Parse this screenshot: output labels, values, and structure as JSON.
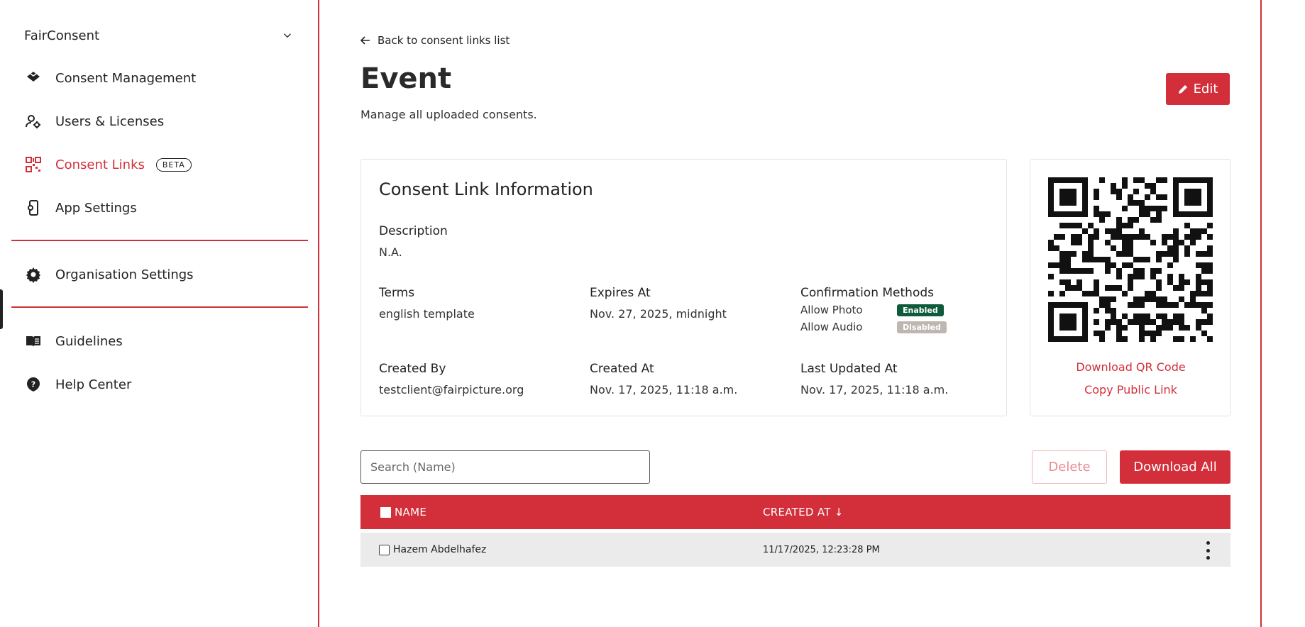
{
  "sidebar": {
    "org_name": "FairConsent",
    "items": [
      {
        "label": "Consent Management",
        "icon": "layers-icon"
      },
      {
        "label": "Users & Licenses",
        "icon": "user-gear-icon"
      },
      {
        "label": "Consent Links",
        "icon": "qr-code-icon",
        "badge": "BETA",
        "active": true
      },
      {
        "label": "App Settings",
        "icon": "device-settings-icon"
      },
      {
        "label": "Organisation Settings",
        "icon": "gear-icon"
      },
      {
        "label": "Guidelines",
        "icon": "book-icon"
      },
      {
        "label": "Help Center",
        "icon": "help-icon"
      }
    ]
  },
  "header": {
    "back_label": "Back to consent links list",
    "title": "Event",
    "subtitle": "Manage all uploaded consents.",
    "edit_label": "Edit"
  },
  "info": {
    "title": "Consent Link Information",
    "description_label": "Description",
    "description_value": "N.A.",
    "terms_label": "Terms",
    "terms_value": "english template",
    "expires_label": "Expires At",
    "expires_value": "Nov. 27, 2025, midnight",
    "methods_label": "Confirmation Methods",
    "methods": [
      {
        "name": "Allow Photo",
        "status": "Enabled"
      },
      {
        "name": "Allow Audio",
        "status": "Disabled"
      }
    ],
    "created_by_label": "Created By",
    "created_by_value": "testclient@fairpicture.org",
    "created_at_label": "Created At",
    "created_at_value": "Nov. 17, 2025, 11:18 a.m.",
    "updated_label": "Last Updated At",
    "updated_value": "Nov. 17, 2025, 11:18 a.m."
  },
  "qr": {
    "download_label": "Download QR Code",
    "copy_label": "Copy Public Link"
  },
  "table_controls": {
    "search_placeholder": "Search (Name)",
    "delete_label": "Delete",
    "download_all_label": "Download All"
  },
  "table": {
    "columns": [
      "NAME",
      "CREATED AT ↓"
    ],
    "rows": [
      {
        "name": "Hazem Abdelhafez",
        "created_at": "11/17/2025, 12:23:28 PM"
      }
    ]
  },
  "colors": {
    "accent": "#d32f3a",
    "enabled": "#0d5b3b",
    "disabled": "#bdb7b0"
  }
}
